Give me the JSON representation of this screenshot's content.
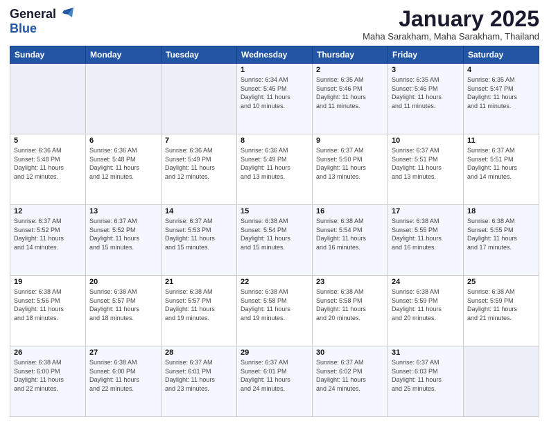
{
  "logo": {
    "general": "General",
    "blue": "Blue"
  },
  "title": "January 2025",
  "subtitle": "Maha Sarakham, Maha Sarakham, Thailand",
  "days_of_week": [
    "Sunday",
    "Monday",
    "Tuesday",
    "Wednesday",
    "Thursday",
    "Friday",
    "Saturday"
  ],
  "weeks": [
    [
      {
        "day": "",
        "info": ""
      },
      {
        "day": "",
        "info": ""
      },
      {
        "day": "",
        "info": ""
      },
      {
        "day": "1",
        "info": "Sunrise: 6:34 AM\nSunset: 5:45 PM\nDaylight: 11 hours\nand 10 minutes."
      },
      {
        "day": "2",
        "info": "Sunrise: 6:35 AM\nSunset: 5:46 PM\nDaylight: 11 hours\nand 11 minutes."
      },
      {
        "day": "3",
        "info": "Sunrise: 6:35 AM\nSunset: 5:46 PM\nDaylight: 11 hours\nand 11 minutes."
      },
      {
        "day": "4",
        "info": "Sunrise: 6:35 AM\nSunset: 5:47 PM\nDaylight: 11 hours\nand 11 minutes."
      }
    ],
    [
      {
        "day": "5",
        "info": "Sunrise: 6:36 AM\nSunset: 5:48 PM\nDaylight: 11 hours\nand 12 minutes."
      },
      {
        "day": "6",
        "info": "Sunrise: 6:36 AM\nSunset: 5:48 PM\nDaylight: 11 hours\nand 12 minutes."
      },
      {
        "day": "7",
        "info": "Sunrise: 6:36 AM\nSunset: 5:49 PM\nDaylight: 11 hours\nand 12 minutes."
      },
      {
        "day": "8",
        "info": "Sunrise: 6:36 AM\nSunset: 5:49 PM\nDaylight: 11 hours\nand 13 minutes."
      },
      {
        "day": "9",
        "info": "Sunrise: 6:37 AM\nSunset: 5:50 PM\nDaylight: 11 hours\nand 13 minutes."
      },
      {
        "day": "10",
        "info": "Sunrise: 6:37 AM\nSunset: 5:51 PM\nDaylight: 11 hours\nand 13 minutes."
      },
      {
        "day": "11",
        "info": "Sunrise: 6:37 AM\nSunset: 5:51 PM\nDaylight: 11 hours\nand 14 minutes."
      }
    ],
    [
      {
        "day": "12",
        "info": "Sunrise: 6:37 AM\nSunset: 5:52 PM\nDaylight: 11 hours\nand 14 minutes."
      },
      {
        "day": "13",
        "info": "Sunrise: 6:37 AM\nSunset: 5:52 PM\nDaylight: 11 hours\nand 15 minutes."
      },
      {
        "day": "14",
        "info": "Sunrise: 6:37 AM\nSunset: 5:53 PM\nDaylight: 11 hours\nand 15 minutes."
      },
      {
        "day": "15",
        "info": "Sunrise: 6:38 AM\nSunset: 5:54 PM\nDaylight: 11 hours\nand 15 minutes."
      },
      {
        "day": "16",
        "info": "Sunrise: 6:38 AM\nSunset: 5:54 PM\nDaylight: 11 hours\nand 16 minutes."
      },
      {
        "day": "17",
        "info": "Sunrise: 6:38 AM\nSunset: 5:55 PM\nDaylight: 11 hours\nand 16 minutes."
      },
      {
        "day": "18",
        "info": "Sunrise: 6:38 AM\nSunset: 5:55 PM\nDaylight: 11 hours\nand 17 minutes."
      }
    ],
    [
      {
        "day": "19",
        "info": "Sunrise: 6:38 AM\nSunset: 5:56 PM\nDaylight: 11 hours\nand 18 minutes."
      },
      {
        "day": "20",
        "info": "Sunrise: 6:38 AM\nSunset: 5:57 PM\nDaylight: 11 hours\nand 18 minutes."
      },
      {
        "day": "21",
        "info": "Sunrise: 6:38 AM\nSunset: 5:57 PM\nDaylight: 11 hours\nand 19 minutes."
      },
      {
        "day": "22",
        "info": "Sunrise: 6:38 AM\nSunset: 5:58 PM\nDaylight: 11 hours\nand 19 minutes."
      },
      {
        "day": "23",
        "info": "Sunrise: 6:38 AM\nSunset: 5:58 PM\nDaylight: 11 hours\nand 20 minutes."
      },
      {
        "day": "24",
        "info": "Sunrise: 6:38 AM\nSunset: 5:59 PM\nDaylight: 11 hours\nand 20 minutes."
      },
      {
        "day": "25",
        "info": "Sunrise: 6:38 AM\nSunset: 5:59 PM\nDaylight: 11 hours\nand 21 minutes."
      }
    ],
    [
      {
        "day": "26",
        "info": "Sunrise: 6:38 AM\nSunset: 6:00 PM\nDaylight: 11 hours\nand 22 minutes."
      },
      {
        "day": "27",
        "info": "Sunrise: 6:38 AM\nSunset: 6:00 PM\nDaylight: 11 hours\nand 22 minutes."
      },
      {
        "day": "28",
        "info": "Sunrise: 6:37 AM\nSunset: 6:01 PM\nDaylight: 11 hours\nand 23 minutes."
      },
      {
        "day": "29",
        "info": "Sunrise: 6:37 AM\nSunset: 6:01 PM\nDaylight: 11 hours\nand 24 minutes."
      },
      {
        "day": "30",
        "info": "Sunrise: 6:37 AM\nSunset: 6:02 PM\nDaylight: 11 hours\nand 24 minutes."
      },
      {
        "day": "31",
        "info": "Sunrise: 6:37 AM\nSunset: 6:03 PM\nDaylight: 11 hours\nand 25 minutes."
      },
      {
        "day": "",
        "info": ""
      }
    ]
  ]
}
